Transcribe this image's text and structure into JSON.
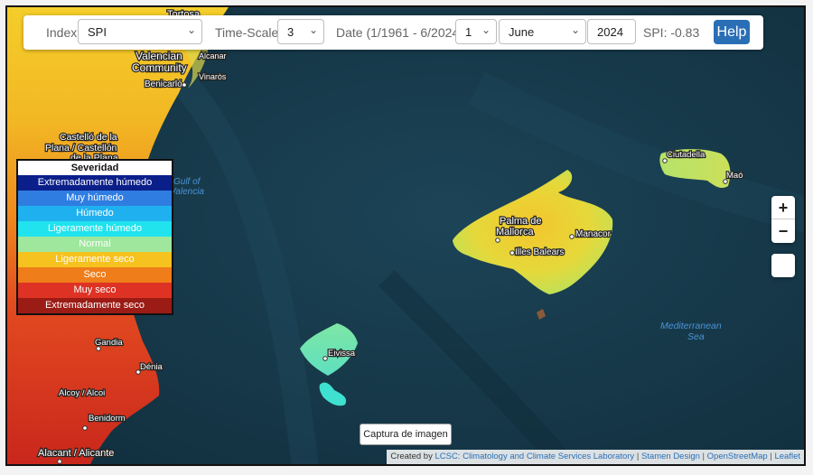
{
  "controls": {
    "index_label": "Index",
    "index_value": "SPI",
    "timescale_label": "Time-Scale",
    "timescale_value": "3",
    "date_label": "Date (1/1961 - 6/2024)",
    "day_value": "1",
    "month_value": "June",
    "year_value": "2024",
    "spi_readout": "SPI: -0.83",
    "help_label": "Help"
  },
  "legend": {
    "title": "Severidad",
    "items": [
      {
        "label": "Extremadamente húmedo",
        "color": "#0b1f8a"
      },
      {
        "label": "Muy húmedo",
        "color": "#2f7de1"
      },
      {
        "label": "Húmedo",
        "color": "#1fb1ef"
      },
      {
        "label": "Ligeramente húmedo",
        "color": "#20e3ee"
      },
      {
        "label": "Normal",
        "color": "#9ee79c"
      },
      {
        "label": "Ligeramente seco",
        "color": "#f6c21f"
      },
      {
        "label": "Seco",
        "color": "#ee7d1a"
      },
      {
        "label": "Muy seco",
        "color": "#de3324"
      },
      {
        "label": "Extremadamente seco",
        "color": "#9b1b15"
      }
    ]
  },
  "zoom": {
    "in": "+",
    "out": "−"
  },
  "capture_label": "Captura de imagen",
  "attribution": {
    "prefix": "Created by",
    "lcsc": "LCSC: Climatology and Climate Services Laboratory",
    "stamen": "Stamen Design",
    "osm": "OpenStreetMap",
    "leaflet": "Leaflet",
    "sep": "|"
  },
  "map_labels": {
    "tortosa": "Tortosa",
    "valencian1": "Valencian",
    "valencian2": "Community",
    "alcanar": "Alcanar",
    "benicarlo": "Benicarló",
    "vinaros": "Vinaròs",
    "castello1": "Castelló de la",
    "castello2": "Plana / Castellón",
    "castello3": "de la Plana",
    "gulf1": "Gulf of",
    "gulf2": "Valencia",
    "palma1": "Palma de",
    "palma2": "Mallorca",
    "illes": "Illes Balears",
    "manacor": "Manacor",
    "ciutadella": "Ciutadella",
    "mao": "Maó",
    "eivissa": "Eivissa",
    "med1": "Mediterranean",
    "med2": "Sea",
    "gandia": "Gandia",
    "denia": "Dénia",
    "alcoy": "Alcoy / Alcoi",
    "benidorm": "Benidorm",
    "alacant": "Alacant / Alicante"
  },
  "colors": {
    "sea": "#173848",
    "accent": "#2a6fb6"
  }
}
